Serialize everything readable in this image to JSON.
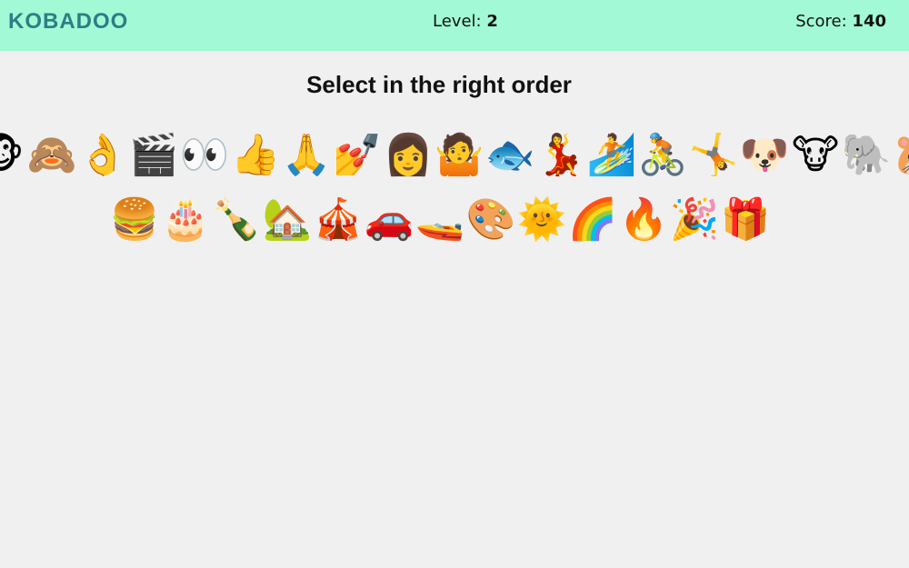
{
  "header": {
    "logo": "KOBADOO",
    "level_label": "Level:",
    "level_value": "2",
    "score_label": "Score:",
    "score_value": "140",
    "background": "#a1fad5",
    "logo_color": "#2e7d84"
  },
  "instruction": "Select in the right order",
  "emoji_row_1": [
    {
      "name": "monkey",
      "char": "🐵"
    },
    {
      "name": "see-no-evil-monkey",
      "char": "🙈"
    },
    {
      "name": "ok-hand",
      "char": "👌"
    },
    {
      "name": "clapper-board",
      "char": "🎬"
    },
    {
      "name": "eyes",
      "char": "👀"
    },
    {
      "name": "thumbs-up",
      "char": "👍"
    },
    {
      "name": "folded-hands",
      "char": "🙏"
    },
    {
      "name": "nail-polish",
      "char": "💅"
    },
    {
      "name": "woman",
      "char": "👩"
    },
    {
      "name": "person-shrugging",
      "char": "🤷"
    },
    {
      "name": "fish",
      "char": "🐟"
    },
    {
      "name": "woman-dancing",
      "char": "💃"
    },
    {
      "name": "person-surfing",
      "char": "🏄"
    },
    {
      "name": "person-biking",
      "char": "🚴"
    },
    {
      "name": "person-cartwheeling",
      "char": "🤸"
    },
    {
      "name": "dog-face",
      "char": "🐶"
    },
    {
      "name": "cow-face",
      "char": "🐮"
    },
    {
      "name": "elephant",
      "char": "🐘"
    },
    {
      "name": "hamster",
      "char": "🐹"
    }
  ],
  "emoji_row_2": [
    {
      "name": "hamburger",
      "char": "🍔"
    },
    {
      "name": "birthday-cake",
      "char": "🎂"
    },
    {
      "name": "champagne",
      "char": "🍾"
    },
    {
      "name": "house-with-garden",
      "char": "🏡"
    },
    {
      "name": "circus-tent",
      "char": "🎪"
    },
    {
      "name": "automobile",
      "char": "🚗"
    },
    {
      "name": "speedboat",
      "char": "🚤"
    },
    {
      "name": "artist-palette",
      "char": "🎨"
    },
    {
      "name": "sun-with-face",
      "char": "🌞"
    },
    {
      "name": "rainbow",
      "char": "🌈"
    },
    {
      "name": "fire",
      "char": "🔥"
    },
    {
      "name": "party-popper",
      "char": "🎉"
    },
    {
      "name": "wrapped-gift",
      "char": "🎁"
    }
  ]
}
